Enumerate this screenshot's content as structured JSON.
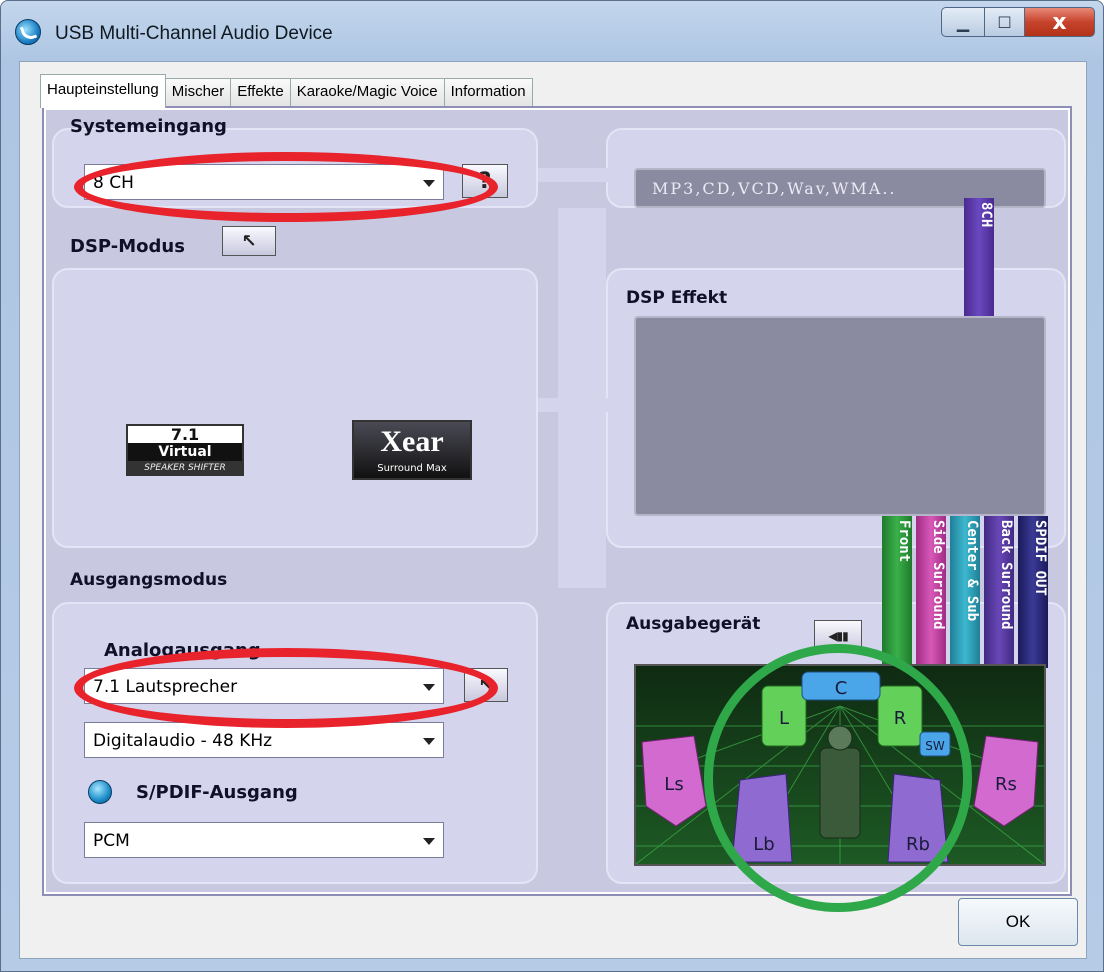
{
  "window": {
    "title": "USB Multi-Channel Audio Device"
  },
  "tabs": [
    {
      "label": "Haupteinstellung"
    },
    {
      "label": "Mischer"
    },
    {
      "label": "Effekte"
    },
    {
      "label": "Karaoke/Magic Voice"
    },
    {
      "label": "Information"
    }
  ],
  "system_input": {
    "header": "Systemeingang",
    "value": "8 CH",
    "help_label": "?"
  },
  "formats_display": "MP3,CD,VCD,Wav,WMA..",
  "dsp_mode": {
    "header": "DSP-Modus",
    "logo1_line1": "7.1",
    "logo1_line2": "Virtual",
    "logo1_line3": "SPEAKER SHIFTER",
    "logo2_main": "Xear",
    "logo2_sub": "Surround Max"
  },
  "dsp_effect": {
    "header": "DSP Effekt",
    "bar_8ch": "8CH"
  },
  "channel_bars": [
    {
      "label": "Front",
      "color": "#2a9a3a"
    },
    {
      "label": "Side Surround",
      "color": "#c040a0"
    },
    {
      "label": "Center & Sub",
      "color": "#2aa0b8"
    },
    {
      "label": "Back Surround",
      "color": "#5a3aa0"
    },
    {
      "label": "SPDIF OUT",
      "color": "#2a2a7a"
    }
  ],
  "output_mode": {
    "header": "Ausgangsmodus",
    "analog_label": "Analogausgang",
    "analog_value": "7.1 Lautsprecher",
    "digital_value": "Digitalaudio - 48 KHz",
    "spdif_label": "S/PDIF-Ausgang",
    "spdif_value": "PCM"
  },
  "output_device": {
    "header": "Ausgabegerät",
    "speakers": [
      "L",
      "C",
      "R",
      "SW",
      "Ls",
      "Rs",
      "Lb",
      "Rb"
    ]
  },
  "ok_label": "OK",
  "colors": {
    "annotation_red": "#e8232b",
    "annotation_green": "#2fa84a"
  }
}
